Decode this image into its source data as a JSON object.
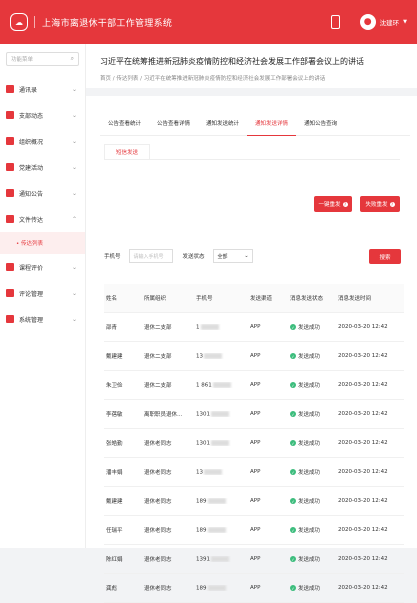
{
  "app": {
    "title": "上海市离退休干部工作管理系统",
    "user": "沈建环",
    "accent": "#e5373c"
  },
  "sidebar": {
    "search_placeholder": "功能菜单",
    "items": [
      {
        "label": "通讯录",
        "expanded": false
      },
      {
        "label": "支部动态",
        "expanded": false
      },
      {
        "label": "组织概况",
        "expanded": false
      },
      {
        "label": "党建活动",
        "expanded": false
      },
      {
        "label": "通知公告",
        "expanded": false
      },
      {
        "label": "文件传达",
        "expanded": true
      },
      {
        "label": "课程评价",
        "expanded": false
      },
      {
        "label": "评论管理",
        "expanded": false
      },
      {
        "label": "系统管理",
        "expanded": false
      }
    ],
    "sub_item": "• 传达列表"
  },
  "page": {
    "title": "习近平在统筹推进新冠肺炎疫情防控和经济社会发展工作部署会议上的讲话",
    "breadcrumb": "首页  /  传达列表  /  习近平在统筹推进新冠肺炎疫情防控和经济社会发展工作部署会议上的讲话"
  },
  "tabs": [
    "公告查看统计",
    "公告查看详情",
    "通知发送统计",
    "通知发送详情",
    "通知公告查询"
  ],
  "active_tab": 3,
  "subtab": "短信发送",
  "buttons": {
    "send_one": "一键重发",
    "fail_resend": "失败重发",
    "search": "搜索"
  },
  "filters": {
    "phone_label": "手机号",
    "phone_placeholder": "请输入手机号",
    "status_label": "发送状态",
    "status_value": "全部"
  },
  "table": {
    "headers": [
      "姓名",
      "所属组织",
      "手机号",
      "发送渠道",
      "消息发送状态",
      "消息发送时间"
    ],
    "rows": [
      [
        "邵青",
        "退休二支部",
        "1",
        "APP",
        "发送成功",
        "2020-03-20 12:42"
      ],
      [
        "戴建建",
        "退休二支部",
        "13",
        "APP",
        "发送成功",
        "2020-03-20 12:42"
      ],
      [
        "朱卫俭",
        "退休二支部",
        "1        861",
        "APP",
        "发送成功",
        "2020-03-20 12:42"
      ],
      [
        "李蓓敏",
        "离职职员退休…",
        "1301",
        "APP",
        "发送成功",
        "2020-03-20 12:42"
      ],
      [
        "张皓勤",
        "退休老同志",
        "1301",
        "APP",
        "发送成功",
        "2020-03-20 12:42"
      ],
      [
        "潘丰娟",
        "退休老同志",
        "13",
        "APP",
        "发送成功",
        "2020-03-20 12:42"
      ],
      [
        "戴建建",
        "退休老同志",
        "189",
        "APP",
        "发送成功",
        "2020-03-20 12:42"
      ],
      [
        "任瑞平",
        "退休老同志",
        "189",
        "APP",
        "发送成功",
        "2020-03-20 12:42"
      ],
      [
        "陈红娟",
        "退休老同志",
        "1391",
        "APP",
        "发送成功",
        "2020-03-20 12:42"
      ],
      [
        "龚彪",
        "退休老同志",
        "189",
        "APP",
        "发送成功",
        "2020-03-20 12:42"
      ]
    ]
  }
}
